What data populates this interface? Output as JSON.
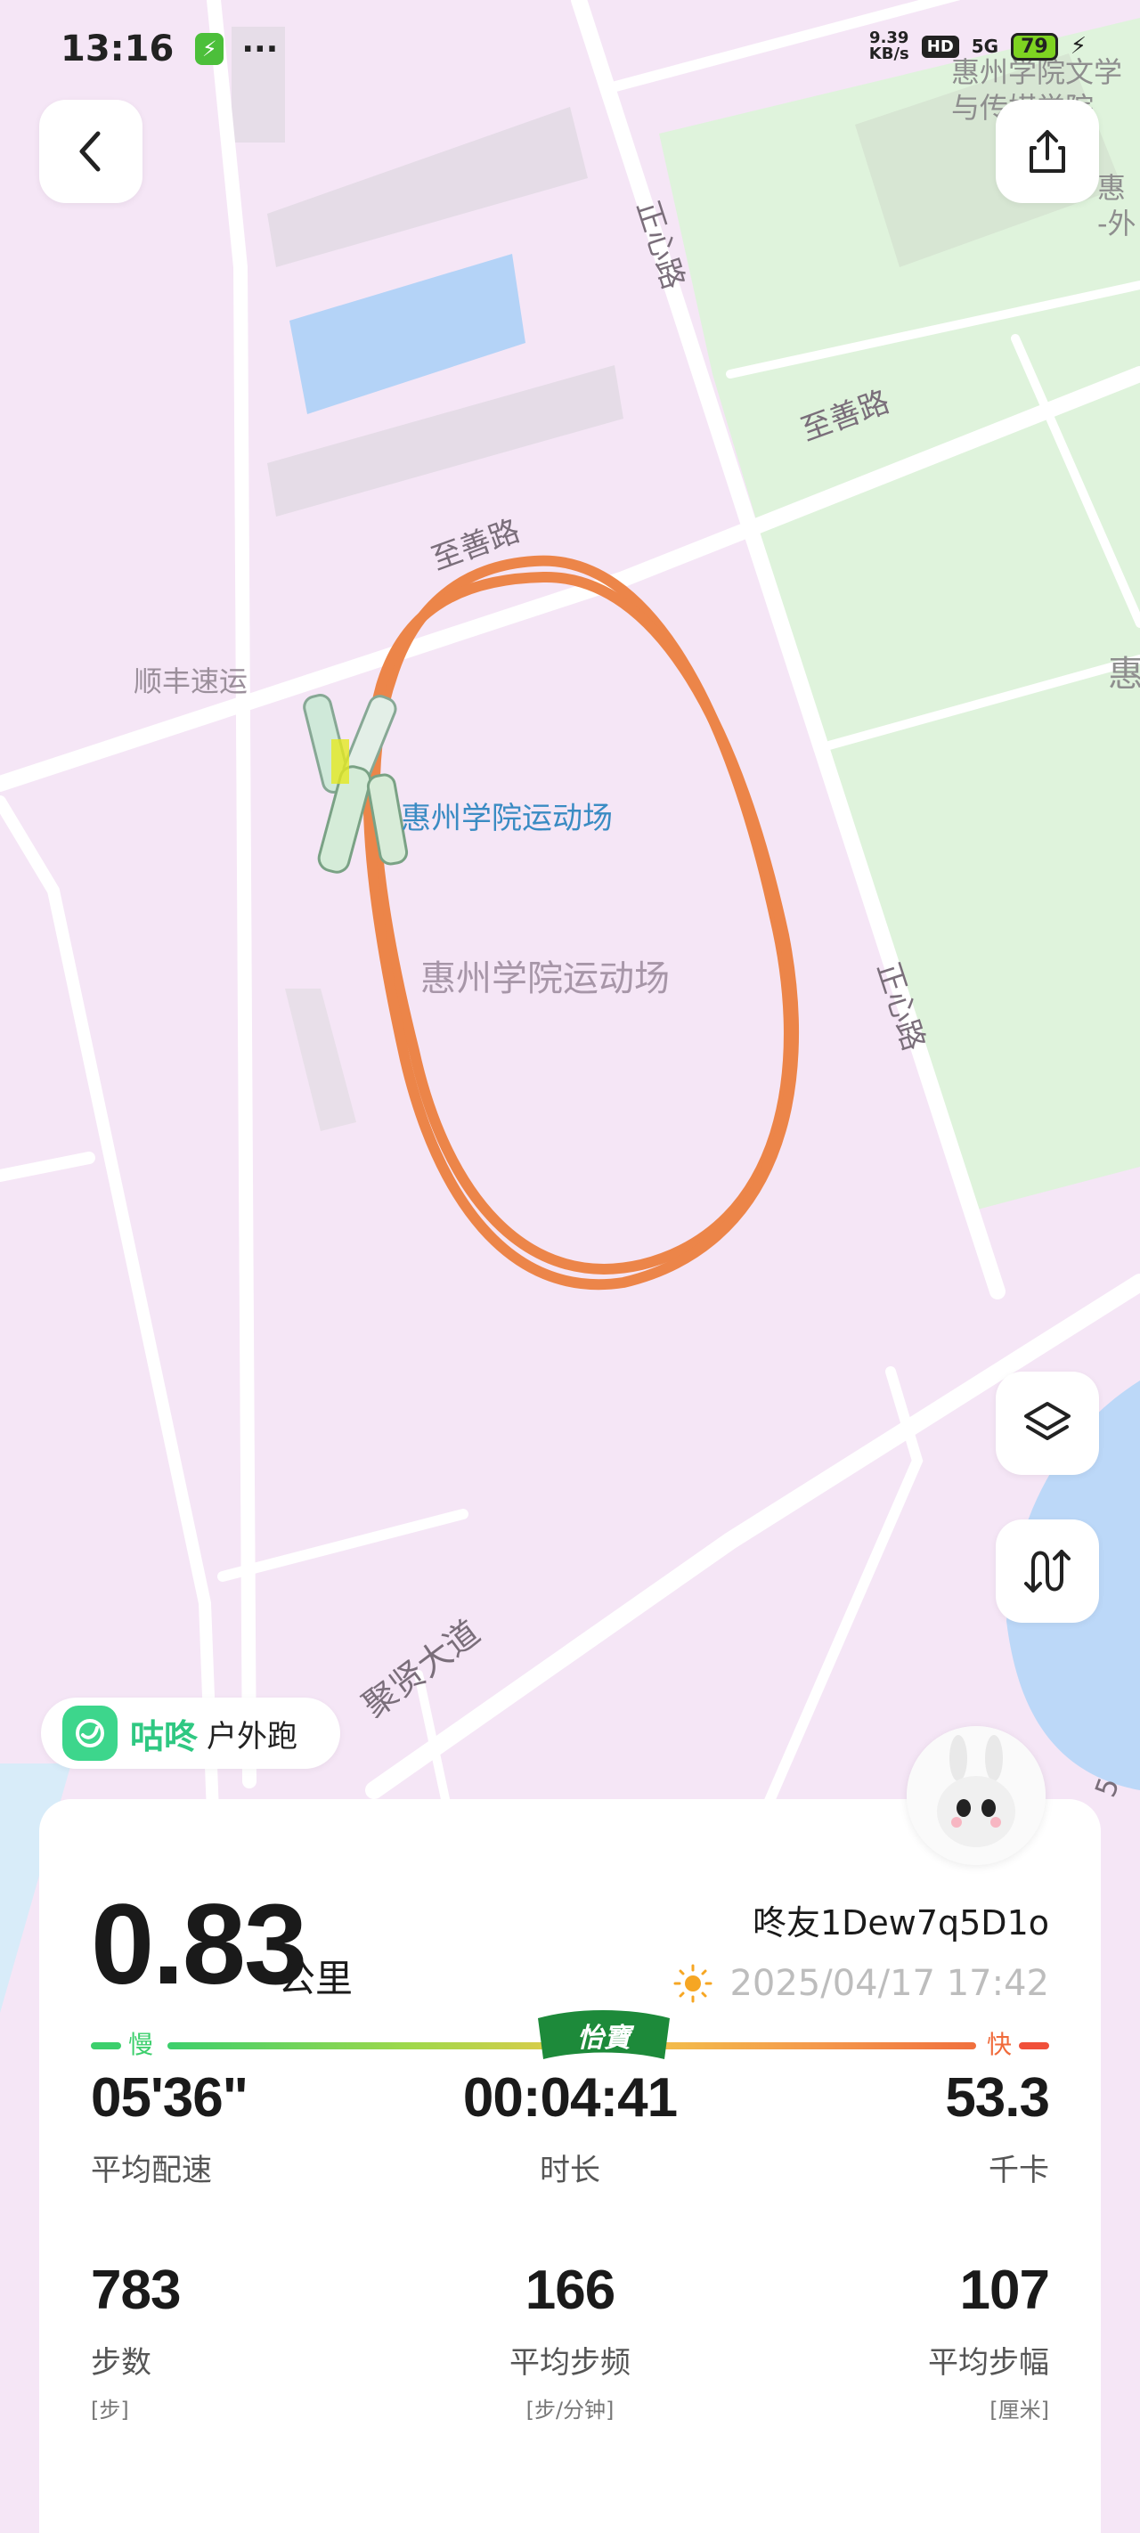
{
  "status_bar": {
    "time": "13:16",
    "more": "···",
    "net_speed_value": "9.39",
    "net_speed_unit": "KB/s",
    "hd": "HD",
    "network": "5G",
    "battery": "79"
  },
  "map": {
    "labels": {
      "road_zhengxin_top": "正心路",
      "road_zhengxin_mid": "正心路",
      "road_zhishan_left": "至善路",
      "road_zhishan_right": "至善路",
      "road_juxian": "聚贤大道",
      "poi_shunfeng": "顺丰速运",
      "poi_stadium_pin": "惠州学院运动场",
      "poi_stadium_area": "惠州学院运动场",
      "poi_college_top": "惠州学院文学与传媒学院",
      "poi_edge_right_1": "惠",
      "poi_edge_right_2": "-外",
      "poi_edge_right_3": "惠",
      "road_edge_bottom": "5"
    },
    "colors": {
      "background": "#f5e6f6",
      "road": "#ffffff",
      "green_area": "#dff2de",
      "water": "#bcd8f8",
      "route": "#ec8549"
    }
  },
  "buttons": {
    "back_icon": "chevron-left-icon",
    "share_icon": "share-icon",
    "layers_icon": "layers-icon",
    "route_icon": "route-icon"
  },
  "brand": {
    "name": "咕咚",
    "activity_type": "户外跑"
  },
  "summary": {
    "distance": "0.83",
    "distance_unit": "公里",
    "user": "咚友1Dew7q5D1o",
    "datetime": "2025/04/17 17:42",
    "pace_slow_label": "慢",
    "pace_fast_label": "快",
    "sponsor": "怡寶"
  },
  "stats": [
    {
      "value": "05'36\"",
      "label": "平均配速",
      "unit": ""
    },
    {
      "value": "00:04:41",
      "label": "时长",
      "unit": ""
    },
    {
      "value": "53.3",
      "label": "千卡",
      "unit": ""
    },
    {
      "value": "783",
      "label": "步数",
      "unit": "[步]"
    },
    {
      "value": "166",
      "label": "平均步频",
      "unit": "[步/分钟]"
    },
    {
      "value": "107",
      "label": "平均步幅",
      "unit": "[厘米]"
    }
  ]
}
